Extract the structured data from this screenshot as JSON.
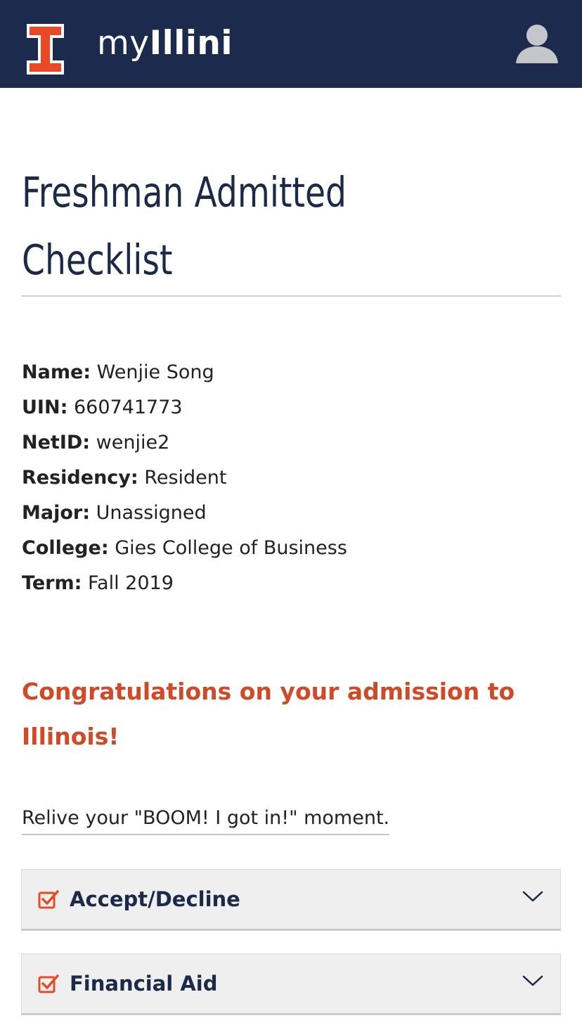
{
  "header": {
    "brand_prefix": "my",
    "brand_name": "Illini",
    "logo_icon": "block-i-logo",
    "user_icon": "user-silhouette-icon",
    "colors": {
      "background": "#1b2a4d",
      "logo": "#e84a27"
    }
  },
  "page": {
    "title": "Freshman Admitted Checklist"
  },
  "student": {
    "fields": [
      {
        "label": "Name:",
        "value": "Wenjie Song"
      },
      {
        "label": "UIN:",
        "value": "660741773"
      },
      {
        "label": "NetID:",
        "value": "wenjie2"
      },
      {
        "label": "Residency:",
        "value": "Resident"
      },
      {
        "label": "Major:",
        "value": "Unassigned"
      },
      {
        "label": "College:",
        "value": "Gies College of Business"
      },
      {
        "label": "Term:",
        "value": "Fall 2019"
      }
    ]
  },
  "congrats": {
    "heading": "Congratulations on your admission to Illinois!",
    "color": "#cf4b28"
  },
  "relive_link": {
    "text": "Relive your \"BOOM! I got in!\" moment."
  },
  "checklist": {
    "items": [
      {
        "label": "Accept/Decline",
        "status_icon": "checked-box-icon",
        "toggle_icon": "chevron-down-icon"
      },
      {
        "label": "Financial Aid",
        "status_icon": "checked-box-icon",
        "toggle_icon": "chevron-down-icon"
      }
    ]
  }
}
